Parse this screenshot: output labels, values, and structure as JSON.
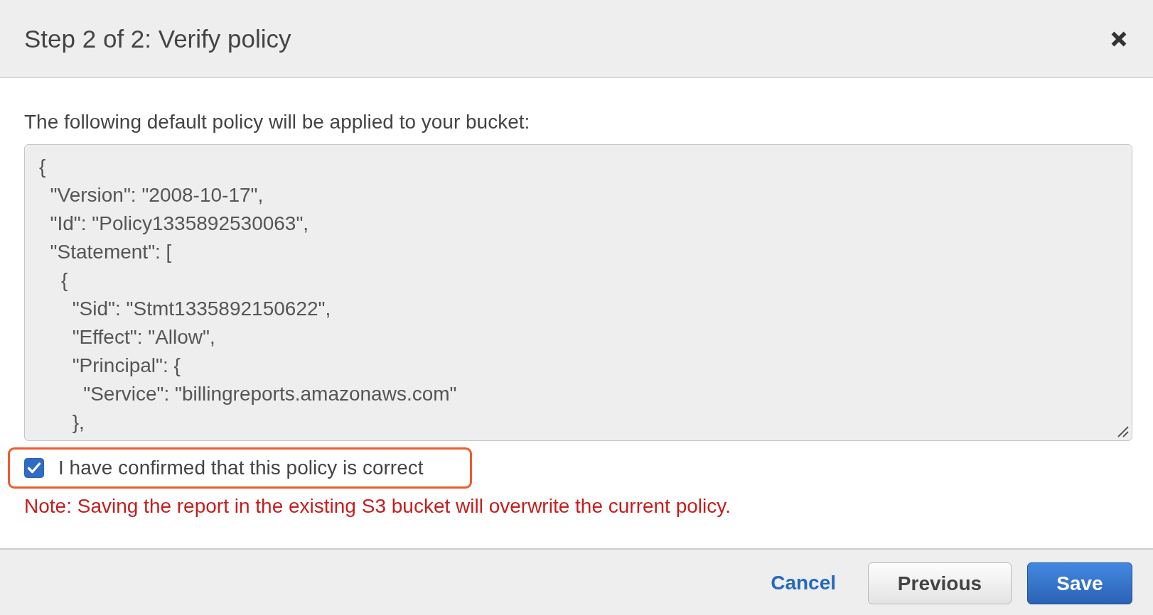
{
  "dialog": {
    "title": "Step 2 of 2: Verify policy"
  },
  "intro": "The following default policy will be applied to your bucket:",
  "policy_field": {
    "value": "{\n  \"Version\": \"2008-10-17\",\n  \"Id\": \"Policy1335892530063\",\n  \"Statement\": [\n    {\n      \"Sid\": \"Stmt1335892150622\",\n      \"Effect\": \"Allow\",\n      \"Principal\": {\n        \"Service\": \"billingreports.amazonaws.com\"\n      },"
  },
  "confirmation": {
    "label": "I have confirmed that this policy is correct",
    "checked": true,
    "highlighted": true
  },
  "note": "Note: Saving the report in the existing S3 bucket will overwrite the current policy.",
  "buttons": [
    {
      "label": "Cancel",
      "kind": "link"
    },
    {
      "label": "Previous",
      "kind": "secondary"
    },
    {
      "label": "Save",
      "kind": "primary"
    }
  ]
}
